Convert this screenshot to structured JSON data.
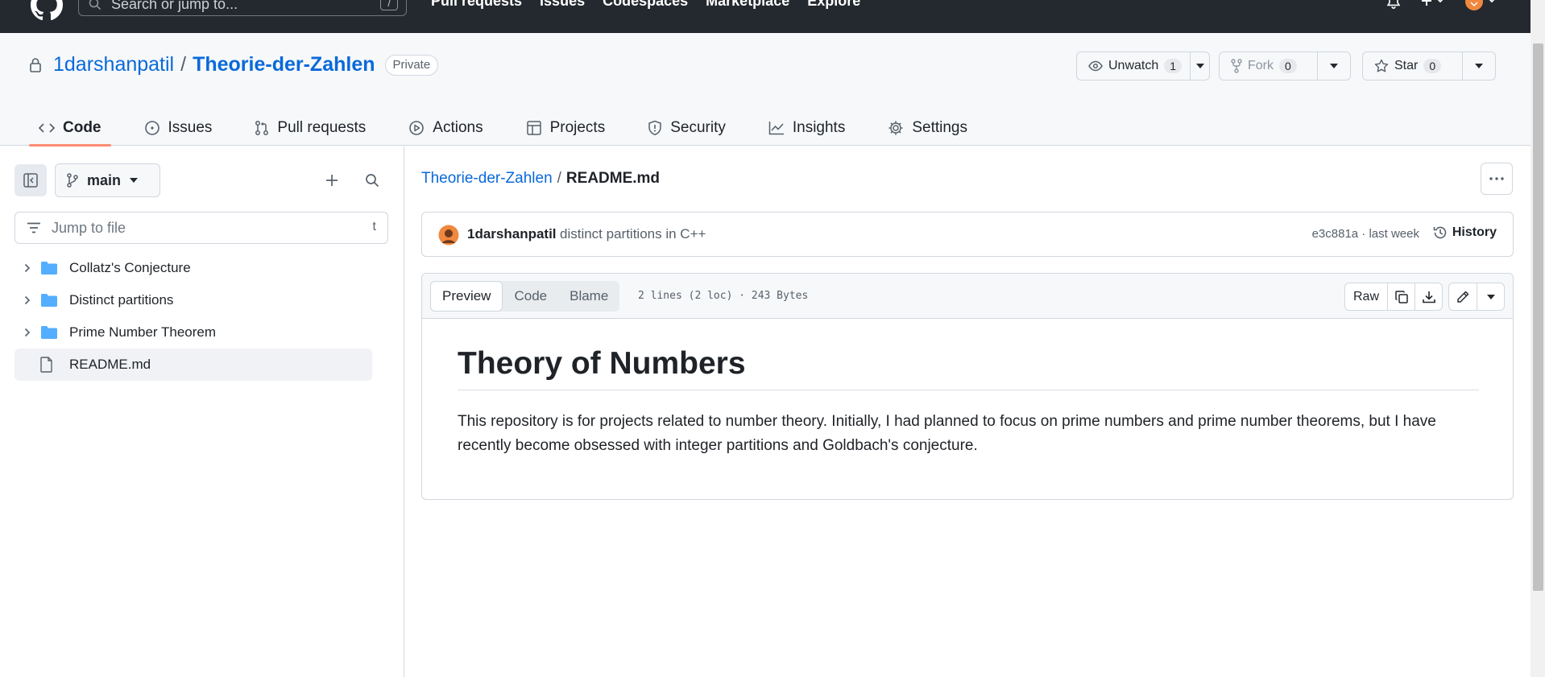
{
  "topbar": {
    "search_placeholder": "Search or jump to...",
    "search_key": "/",
    "nav": [
      "Pull requests",
      "Issues",
      "Codespaces",
      "Marketplace",
      "Explore"
    ]
  },
  "repo": {
    "owner": "1darshanpatil",
    "separator": "/",
    "name": "Theorie-der-Zahlen",
    "visibility": "Private",
    "watch": {
      "label": "Unwatch",
      "count": "1"
    },
    "fork": {
      "label": "Fork",
      "count": "0"
    },
    "star": {
      "label": "Star",
      "count": "0"
    }
  },
  "tabs": [
    {
      "label": "Code",
      "icon": "code-icon",
      "active": true
    },
    {
      "label": "Issues",
      "icon": "issue-icon"
    },
    {
      "label": "Pull requests",
      "icon": "pull-request-icon"
    },
    {
      "label": "Actions",
      "icon": "play-icon"
    },
    {
      "label": "Projects",
      "icon": "table-icon"
    },
    {
      "label": "Security",
      "icon": "shield-icon"
    },
    {
      "label": "Insights",
      "icon": "graph-icon"
    },
    {
      "label": "Settings",
      "icon": "gear-icon"
    }
  ],
  "sidebar": {
    "branch": "main",
    "jump_placeholder": "Jump to file",
    "jump_key": "t",
    "tree": [
      {
        "label": "Collatz's Conjecture",
        "type": "folder"
      },
      {
        "label": "Distinct partitions",
        "type": "folder"
      },
      {
        "label": "Prime Number Theorem",
        "type": "folder"
      },
      {
        "label": "README.md",
        "type": "file",
        "selected": true
      }
    ]
  },
  "file": {
    "repo_link": "Theorie-der-Zahlen",
    "separator": "/",
    "name": "README.md",
    "commit": {
      "author": "1darshanpatil",
      "message": "distinct partitions in C++",
      "sha_time": "e3c881a · last week",
      "history": "History"
    },
    "views": [
      "Preview",
      "Code",
      "Blame"
    ],
    "info": "2 lines (2 loc) · 243 Bytes",
    "raw": "Raw"
  },
  "readme": {
    "heading": "Theory of Numbers",
    "paragraph": "This repository is for projects related to number theory. Initially, I had planned to focus on prime numbers and prime number theorems, but I have recently become obsessed with integer partitions and Goldbach's conjecture."
  },
  "colors": {
    "link": "#0969da",
    "active_tab_underline": "#fd8c73",
    "header_bg": "#24292f",
    "folder": "#54aeff"
  }
}
